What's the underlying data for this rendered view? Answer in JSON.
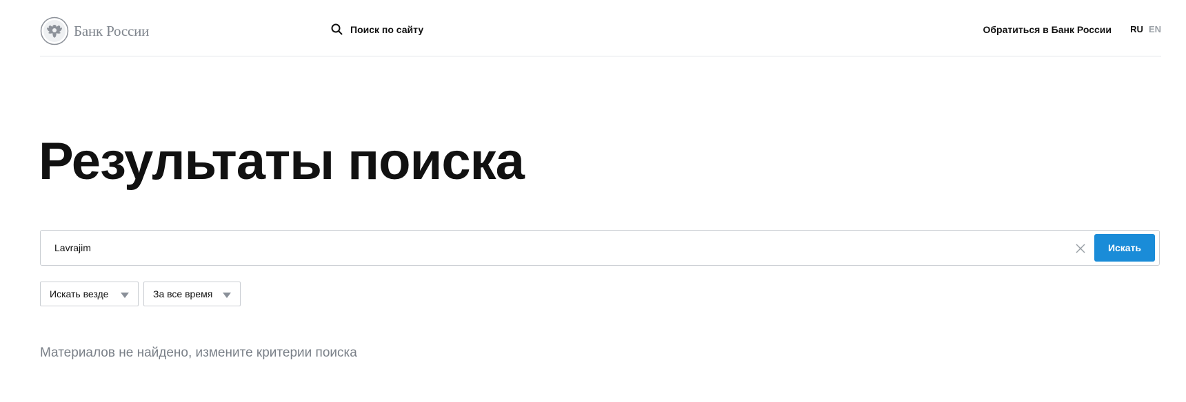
{
  "header": {
    "logo_text": "Банк России",
    "site_search_label": "Поиск по сайту",
    "contact_link": "Обратиться в Банк России",
    "lang_ru": "RU",
    "lang_en": "EN"
  },
  "main": {
    "title": "Результаты поиска",
    "search": {
      "value": "Lavrajim",
      "button_label": "Искать"
    },
    "filters": {
      "scope": "Искать везде",
      "period": "За все время"
    },
    "empty_message": "Материалов не найдено, измените критерии поиска"
  },
  "colors": {
    "accent": "#1a8cd8",
    "muted_text": "#7a8088",
    "border": "#c9cdd2"
  },
  "icons": [
    "emblem-icon",
    "search-icon",
    "close-icon",
    "chevron-down-icon"
  ]
}
